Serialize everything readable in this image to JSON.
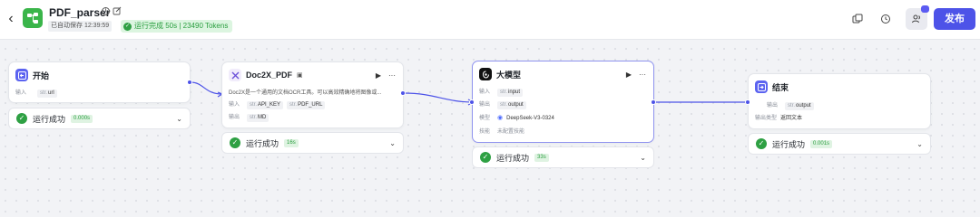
{
  "header": {
    "title": "PDF_parser",
    "autosave": "已自动保存 12:39:59",
    "run_status": "运行完成 50s | 23490 Tokens",
    "publish_label": "发布",
    "colors": {
      "accent": "#4d53e8",
      "success": "#2ea043",
      "logo": "#3ab54a"
    }
  },
  "nodes": {
    "start": {
      "title": "开始",
      "input_label": "输入",
      "input_type": "str.",
      "input_name": "url",
      "result_label": "运行成功",
      "result_time": "0.000s",
      "icon": "start-icon"
    },
    "doc2x": {
      "title": "Doc2X_PDF",
      "description": "Doc2X是一个通用的文档OCR工具。可以高效精确地将图像或...",
      "input_label": "输入",
      "inputs": [
        {
          "type": "str.",
          "name": "API_KEY"
        },
        {
          "type": "str.",
          "name": "PDF_URL"
        }
      ],
      "output_label": "输出",
      "output_type": "str.",
      "output_name": "MD",
      "result_label": "运行成功",
      "result_time": "16s",
      "icon": "plugin-icon"
    },
    "llm": {
      "title": "大模型",
      "input_label": "输入",
      "input_type": "str.",
      "input_name": "input",
      "output_label": "输出",
      "output_type": "str.",
      "output_name": "output",
      "model_label": "模型",
      "model_name": "DeepSeek-V3-0324",
      "skill_label": "技能",
      "skill_value": "未配置技能",
      "result_label": "运行成功",
      "result_time": "33s",
      "icon": "llm-icon"
    },
    "end": {
      "title": "结束",
      "output_label": "输出",
      "output_type": "str.",
      "output_name": "output",
      "output_type_label": "输出类型",
      "output_type_value": "返回文本",
      "result_label": "运行成功",
      "result_time": "0.001s",
      "icon": "end-icon"
    }
  }
}
